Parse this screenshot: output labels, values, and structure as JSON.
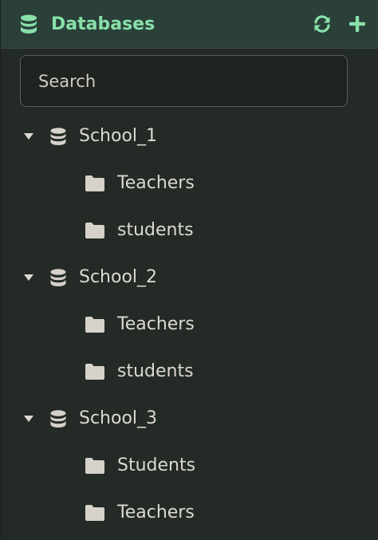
{
  "header": {
    "title": "Databases",
    "icons": {
      "db": "database-icon",
      "refresh": "refresh-icon",
      "add": "plus-icon"
    }
  },
  "search": {
    "placeholder": "Search",
    "value": ""
  },
  "colors": {
    "header_bg": "#2a4039",
    "accent": "#88e0a9",
    "panel_bg": "#242a26",
    "text": "#dcd9d2"
  },
  "databases": [
    {
      "name": "School_1",
      "collections": [
        {
          "name": "Teachers"
        },
        {
          "name": "students"
        }
      ]
    },
    {
      "name": "School_2",
      "collections": [
        {
          "name": "Teachers"
        },
        {
          "name": "students"
        }
      ]
    },
    {
      "name": "School_3",
      "collections": [
        {
          "name": "Students"
        },
        {
          "name": "Teachers"
        }
      ]
    }
  ]
}
